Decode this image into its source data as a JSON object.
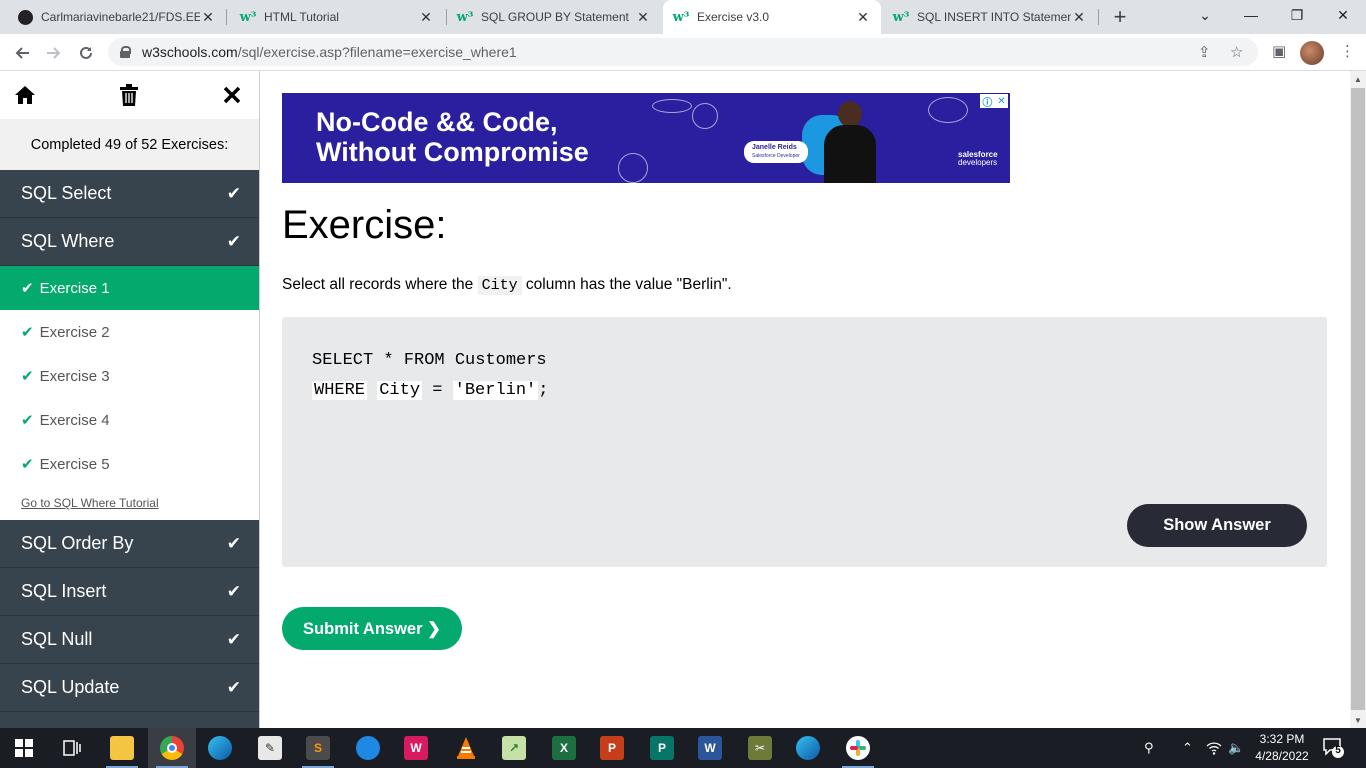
{
  "browser": {
    "tabs": [
      {
        "title": "Carlmariavinebarle21/FDS.EE",
        "icon": "github-icon",
        "active": false
      },
      {
        "title": "HTML Tutorial",
        "icon": "w3schools-icon",
        "active": false
      },
      {
        "title": "SQL GROUP BY Statement",
        "icon": "w3schools-icon",
        "active": false
      },
      {
        "title": "Exercise v3.0",
        "icon": "w3schools-icon",
        "active": true
      },
      {
        "title": "SQL INSERT INTO Statement",
        "icon": "w3schools-icon",
        "active": false
      }
    ],
    "url_host": "w3schools.com",
    "url_path": "/sql/exercise.asp?filename=exercise_where1"
  },
  "sidebar": {
    "completed": "Completed 49 of 52 Exercises:",
    "categories_top": [
      {
        "label": "SQL Select"
      },
      {
        "label": "SQL Where"
      }
    ],
    "exercises": [
      {
        "label": "Exercise 1",
        "active": true
      },
      {
        "label": "Exercise 2",
        "active": false
      },
      {
        "label": "Exercise 3",
        "active": false
      },
      {
        "label": "Exercise 4",
        "active": false
      },
      {
        "label": "Exercise 5",
        "active": false
      }
    ],
    "tutorial_link": "Go to SQL Where Tutorial",
    "categories_bottom": [
      {
        "label": "SQL Order By"
      },
      {
        "label": "SQL Insert"
      },
      {
        "label": "SQL Null"
      },
      {
        "label": "SQL Update"
      }
    ]
  },
  "ad": {
    "headline_1": "No-Code && Code,",
    "headline_2": "Without Compromise",
    "badge_name": "Janelle Reids",
    "badge_role": "Salesforce Developer",
    "brand_1": "salesforce",
    "brand_2": "developers"
  },
  "exercise": {
    "title": "Exercise:",
    "instruction_before": "Select all records where the ",
    "instruction_code": "City",
    "instruction_after": " column has the value \"Berlin\".",
    "code_line1": "SELECT * FROM Customers",
    "code_blank1": "WHERE",
    "code_blank2": "City",
    "code_op": " = ",
    "code_blank3": "'Berlin'",
    "code_end": ";",
    "show_answer": "Show Answer",
    "submit": "Submit Answer ❯"
  },
  "taskbar": {
    "time": "3:32 PM",
    "date": "4/28/2022",
    "notifications": "5"
  },
  "colors": {
    "w3_green": "#04aa6d",
    "sidebar_dark": "#38444d",
    "button_dark": "#282a35",
    "ad_bg": "#2a1f9e"
  }
}
